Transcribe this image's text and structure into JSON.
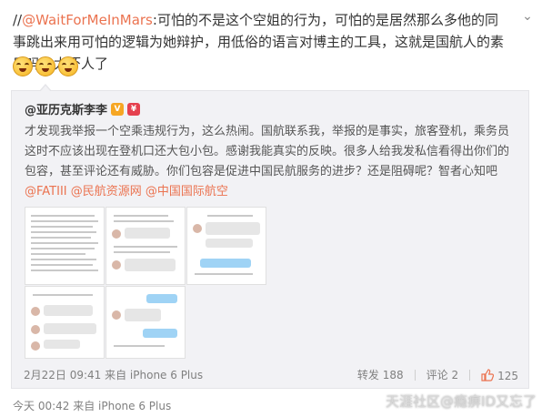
{
  "post": {
    "prefix": "//",
    "mention": "@WaitForMeInMars",
    "text": ":可怕的不是这个空姐的行为，可怕的是居然那么多他的同事跳出来用可怕的逻辑为她辩护，用低俗的语言对博主的工具，这就是国航人的素质吗，太吓人了",
    "emojis": [
      "shocked-face-icon",
      "shocked-face-icon",
      "shocked-face-icon"
    ]
  },
  "original": {
    "author": "@亚历克斯李李",
    "badge_v": "V",
    "badge_r": "¥",
    "text": "才发现我举报一个空乘违规行为，这么热闹。国航联系我，举报的是事实，旅客登机，乘务员这时不应该出现在登机口还大包小包。感谢我能真实的反映。很多人给我发私信看得出你们的包容，甚至评论还有威胁。你们包容是促进中国民航服务的进步？还是阻碍呢？智者心知吧",
    "mentions": [
      "@FATIII",
      "@民航资源网",
      "@中国国际航空"
    ],
    "timestamp": "2月22日 09:41 来自 iPhone 6 Plus",
    "repost_label": "转发 188",
    "comment_label": "评论 2",
    "like_count": "125"
  },
  "footer": {
    "timestamp": "今天 00:42 来自 iPhone 6 Plus"
  },
  "watermark": "天涯社区@瘾痹ID又忘了",
  "colors": {
    "link": "#eb7350",
    "repost_bg": "#f2f2f5"
  }
}
